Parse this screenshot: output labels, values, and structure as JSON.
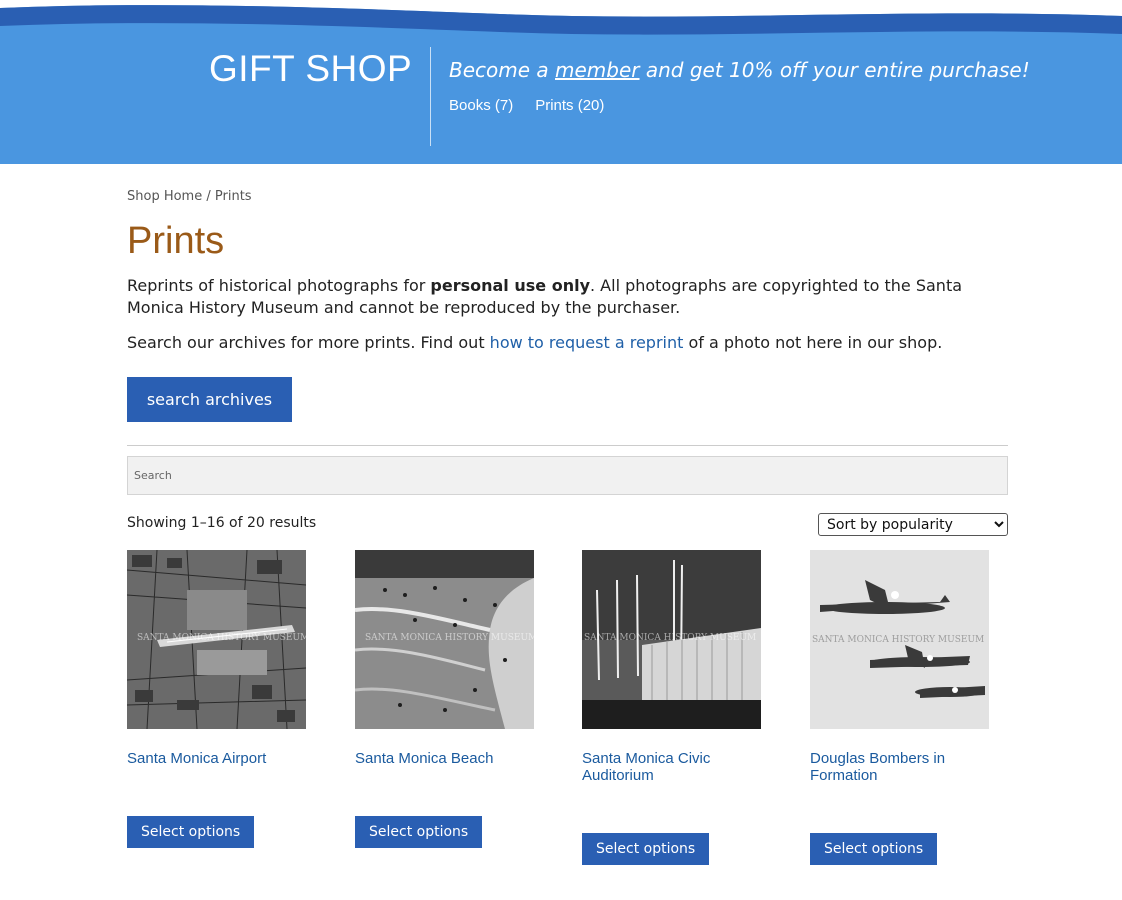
{
  "header": {
    "title": "GIFT SHOP",
    "promo_prefix": "Become a ",
    "promo_link": "member",
    "promo_suffix": " and get 10% off your entire purchase!",
    "categories": [
      {
        "label": "Books (7)"
      },
      {
        "label": "Prints (20)"
      }
    ],
    "colors": {
      "background": "#4a96e0",
      "wave": "#2a5fb3"
    }
  },
  "breadcrumb": {
    "home": "Shop Home",
    "separator": " / ",
    "current": "Prints"
  },
  "page": {
    "title": "Prints",
    "intro_prefix": "Reprints of historical photographs for ",
    "intro_bold": "personal use only",
    "intro_suffix": ". All photographs are copyrighted to the Santa Monica History Museum and cannot be reproduced by the purchaser.",
    "intro2_prefix": "Search our archives for more prints. Find out ",
    "intro2_link": "how to request a reprint",
    "intro2_suffix": " of a photo not here in our shop.",
    "archives_button": "search archives"
  },
  "search": {
    "placeholder": "Search"
  },
  "results": {
    "count_text": "Showing 1–16 of 20 results",
    "sort_selected": "Sort by popularity"
  },
  "products": [
    {
      "title": "Santa Monica Airport",
      "button": "Select options",
      "image_icon": "aerial-photo"
    },
    {
      "title": "Santa Monica Beach",
      "button": "Select options",
      "image_icon": "beach-photo"
    },
    {
      "title": "Santa Monica Civic Auditorium",
      "button": "Select options",
      "image_icon": "auditorium-photo"
    },
    {
      "title": "Douglas Bombers in Formation",
      "button": "Select options",
      "image_icon": "bombers-photo"
    }
  ],
  "watermark": "SANTA MONICA HISTORY MUSEUM",
  "accent_color": "#2a5fb3",
  "title_color": "#9a5a18"
}
